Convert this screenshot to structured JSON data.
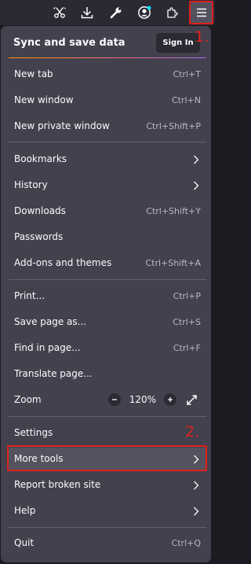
{
  "toolbar": {
    "icons": [
      "screenshot-icon",
      "downloads-icon",
      "extensions-wrench-icon",
      "account-icon",
      "puzzle-icon",
      "hamburger-menu-icon"
    ],
    "account_badge_color": "#00ddff"
  },
  "annotations": {
    "step1": "1.",
    "step2": "2.",
    "color": "#e0201e"
  },
  "menu": {
    "sync_title": "Sync and save data",
    "sign_in": "Sign In",
    "new_tab": {
      "label": "New tab",
      "shortcut": "Ctrl+T"
    },
    "new_window": {
      "label": "New window",
      "shortcut": "Ctrl+N"
    },
    "new_private_window": {
      "label": "New private window",
      "shortcut": "Ctrl+Shift+P"
    },
    "bookmarks": {
      "label": "Bookmarks"
    },
    "history": {
      "label": "History"
    },
    "downloads": {
      "label": "Downloads",
      "shortcut": "Ctrl+Shift+Y"
    },
    "passwords": {
      "label": "Passwords"
    },
    "addons": {
      "label": "Add-ons and themes",
      "shortcut": "Ctrl+Shift+A"
    },
    "print": {
      "label": "Print...",
      "shortcut": "Ctrl+P"
    },
    "save_page": {
      "label": "Save page as...",
      "shortcut": "Ctrl+S"
    },
    "find": {
      "label": "Find in page...",
      "shortcut": "Ctrl+F"
    },
    "translate": {
      "label": "Translate page..."
    },
    "zoom": {
      "label": "Zoom",
      "value": "120%"
    },
    "settings": {
      "label": "Settings"
    },
    "more_tools": {
      "label": "More tools"
    },
    "report": {
      "label": "Report broken site"
    },
    "help": {
      "label": "Help"
    },
    "quit": {
      "label": "Quit",
      "shortcut": "Ctrl+Q"
    }
  }
}
